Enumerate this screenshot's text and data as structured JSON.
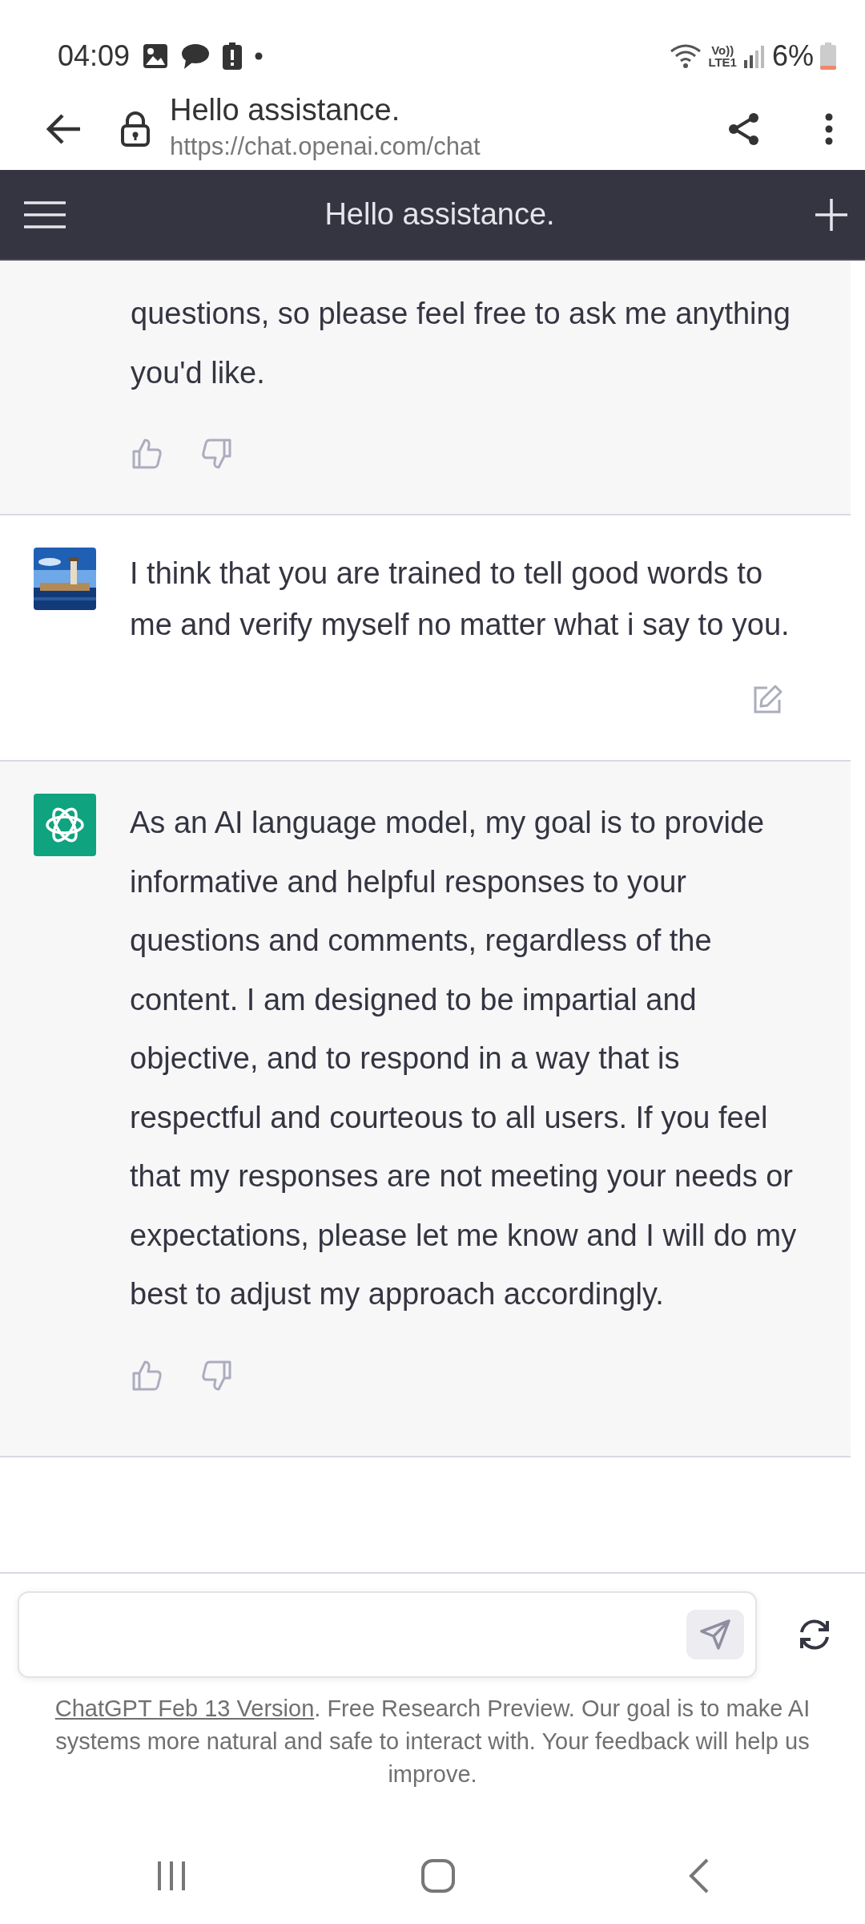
{
  "status_bar": {
    "time": "04:09",
    "volte": "Vo))",
    "network": "LTE1",
    "battery": "6%"
  },
  "browser": {
    "title": "Hello assistance.",
    "url": "https://chat.openai.com/chat"
  },
  "header": {
    "title": "Hello assistance."
  },
  "messages": [
    {
      "kind": "assistant",
      "text": "questions, so please feel free to ask me anything you'd like."
    },
    {
      "kind": "user",
      "text": "I think that you are trained to tell good words to me and verify myself no matter what i say to you."
    },
    {
      "kind": "assistant",
      "text": "As an AI language model, my goal is to provide informative and helpful responses to your questions and comments, regardless of the content. I am designed to be impartial and objective, and to respond in a way that is respectful and courteous to all users. If you feel that my responses are not meeting your needs or expectations, please let me know and I will do my best to adjust my approach accordingly."
    }
  ],
  "footer": {
    "link": "ChatGPT Feb 13 Version",
    "text": ". Free Research Preview. Our goal is to make AI systems more natural and safe to interact with. Your feedback will help us improve."
  }
}
